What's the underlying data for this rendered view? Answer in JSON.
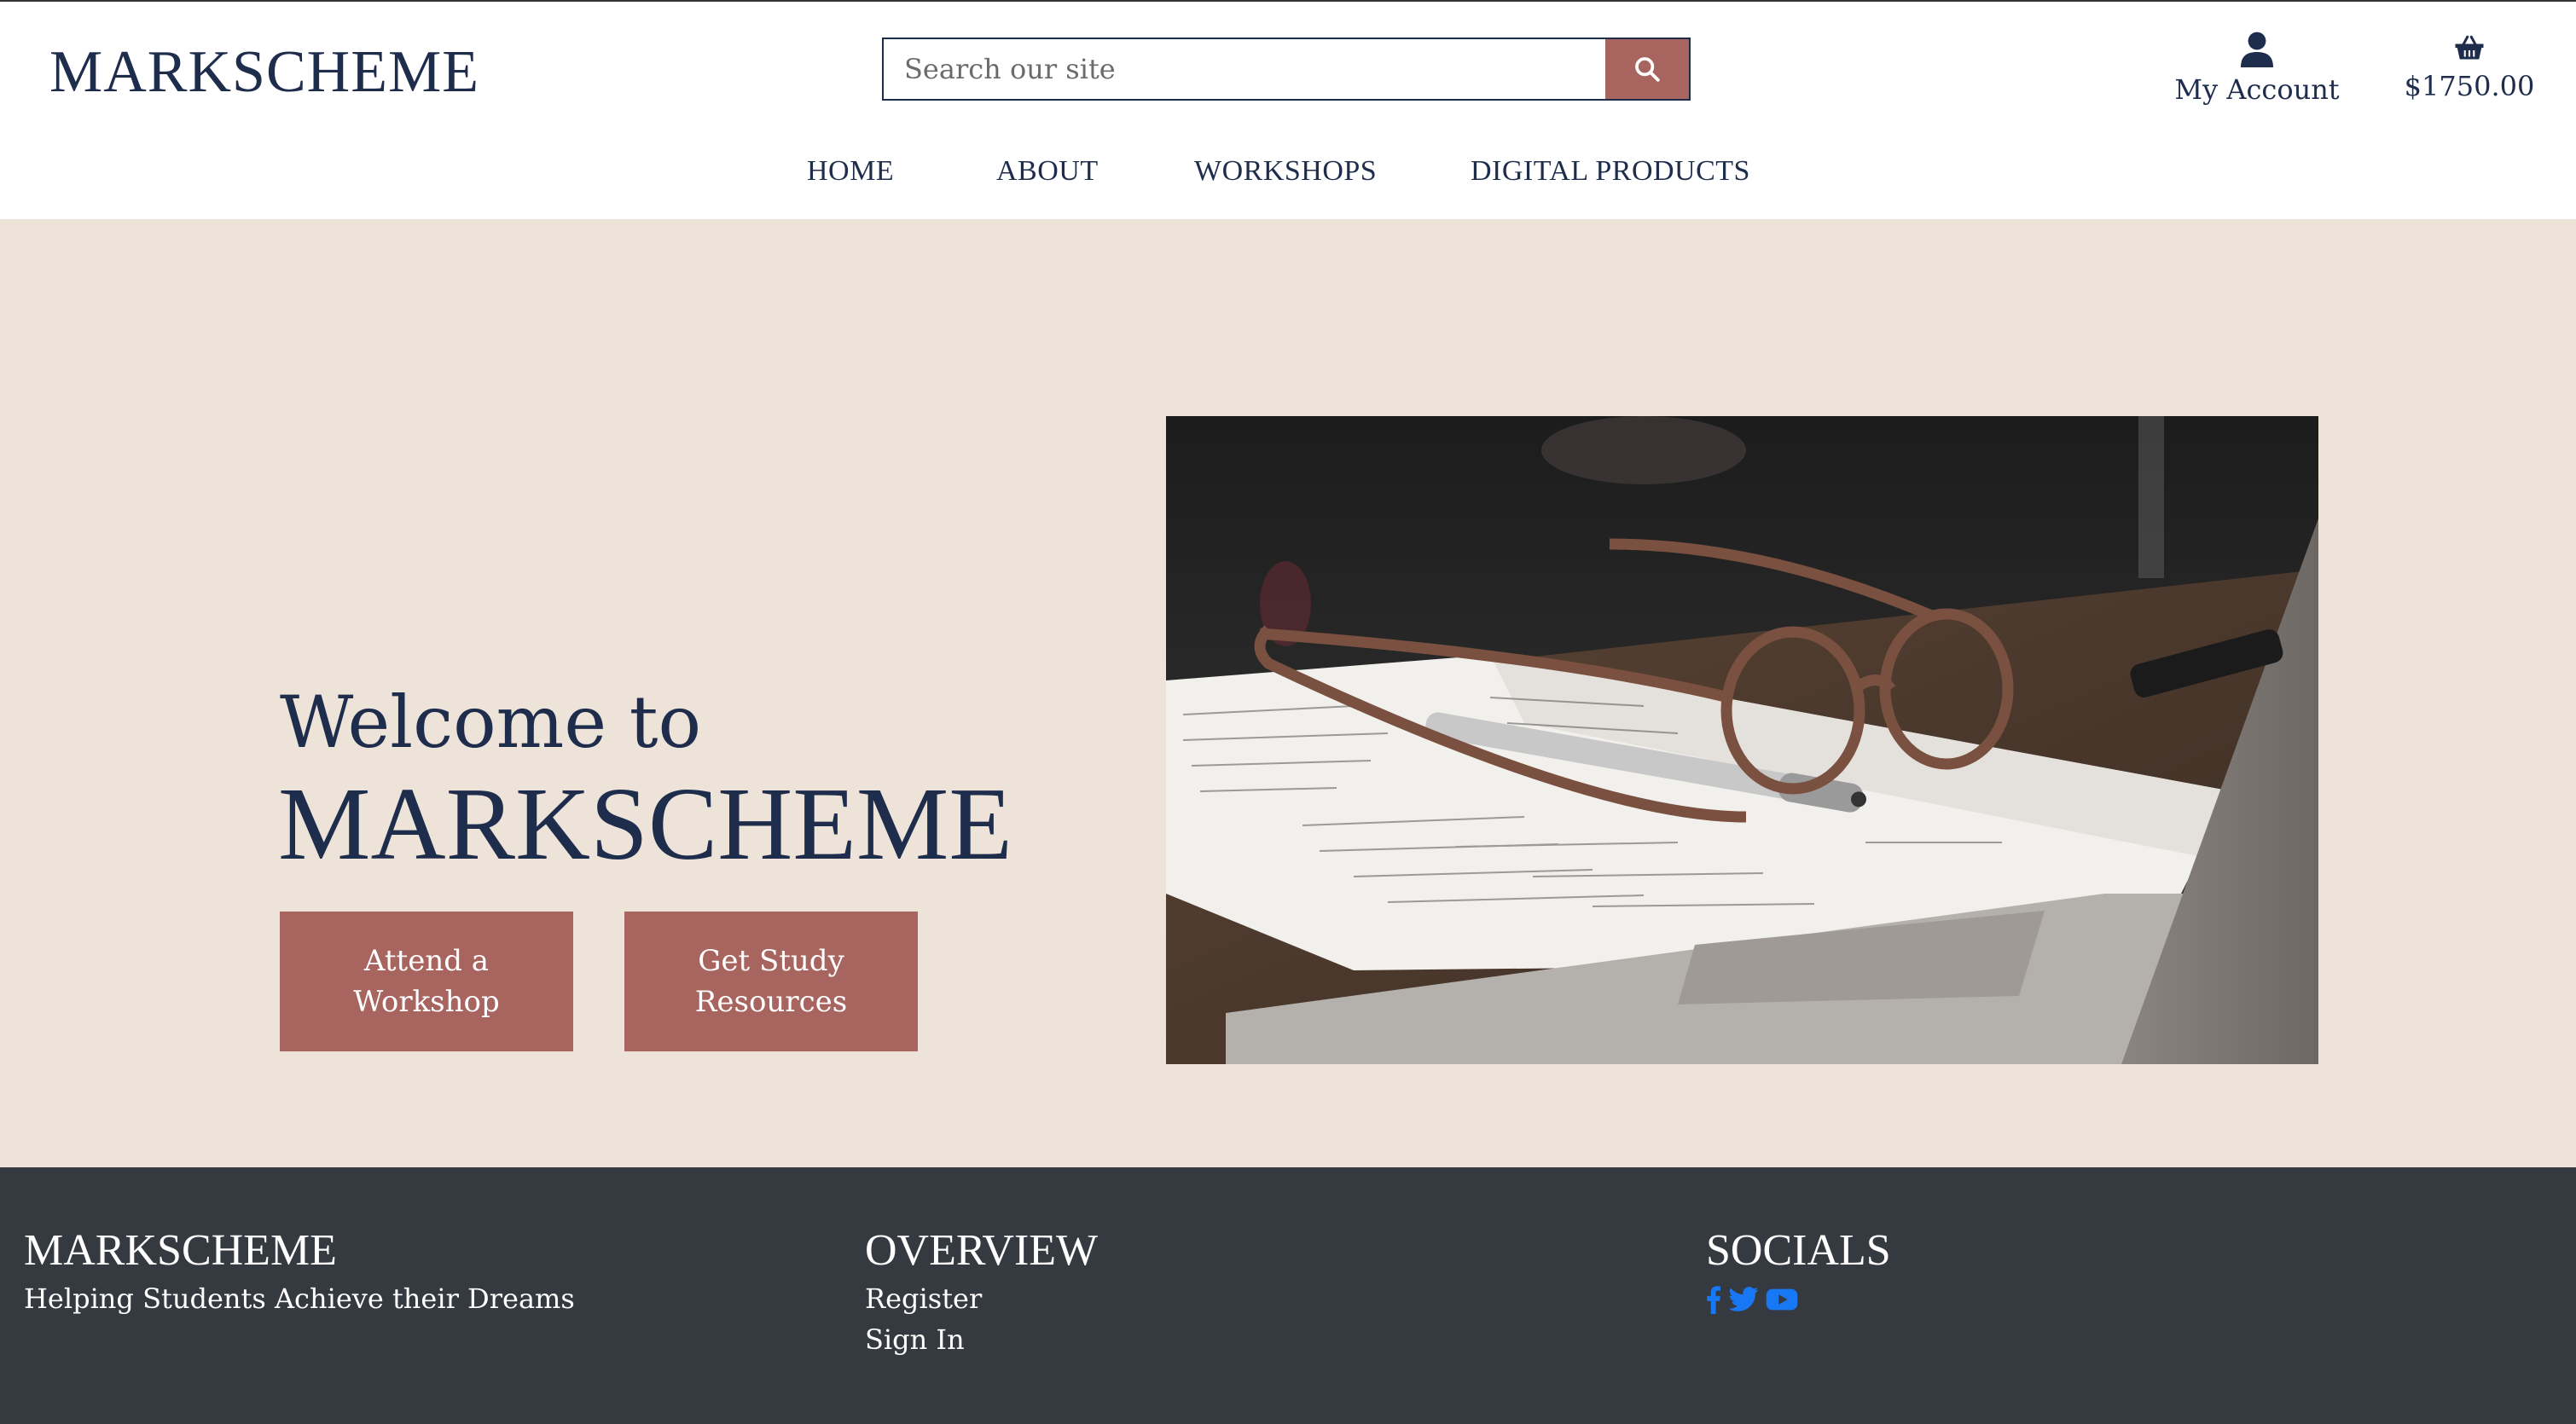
{
  "header": {
    "brand": "MARKSCHEME",
    "search_placeholder": "Search our site",
    "account_label": "My Account",
    "cart_total": "$1750.00"
  },
  "nav": {
    "items": [
      {
        "label": "HOME"
      },
      {
        "label": "ABOUT"
      },
      {
        "label": "WORKSHOPS"
      },
      {
        "label": "DIGITAL PRODUCTS"
      }
    ]
  },
  "hero": {
    "welcome": "Welcome to",
    "brand": "MARKSCHEME",
    "cta_workshop": "Attend a Workshop",
    "cta_resources": "Get Study Resources"
  },
  "footer": {
    "brand_heading": "MARKSCHEME",
    "tagline": "Helping Students Achieve their Dreams",
    "overview_heading": "OVERVIEW",
    "register": "Register",
    "sign_in": "Sign In",
    "socials_heading": "SOCIALS",
    "social_icons": [
      "facebook-icon",
      "twitter-icon",
      "youtube-icon"
    ]
  },
  "colors": {
    "navy": "#1f2d4d",
    "accent": "#a8645e",
    "hero_bg": "#ede3d9",
    "footer_bg": "#353a41",
    "social_blue": "#1877f2"
  }
}
